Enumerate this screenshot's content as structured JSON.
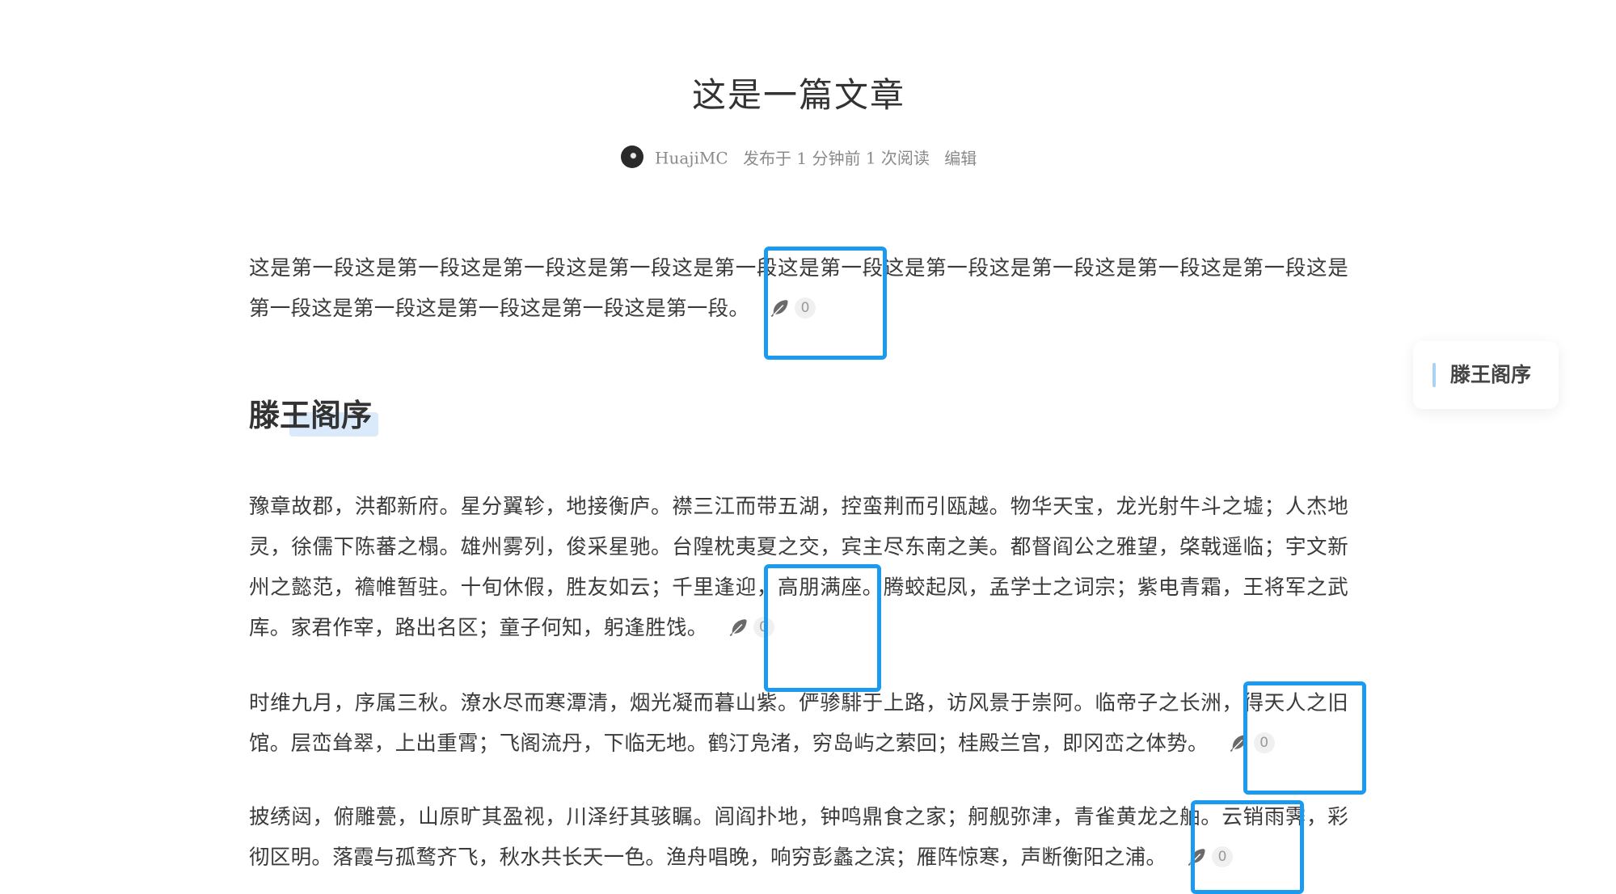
{
  "article": {
    "title": "这是一篇文章",
    "meta": {
      "author": "HuajiMC",
      "published": "发布于 1 分钟前",
      "reads": "1 次阅读",
      "edit_label": "编辑"
    },
    "paragraphs": [
      {
        "text": "这是第一段这是第一段这是第一段这是第一段这是第一段这是第一段这是第一段这是第一段这是第一段这是第一段这是第一段这是第一段这是第一段这是第一段这是第一段。",
        "comment_count": "0"
      },
      {
        "text": "豫章故郡，洪都新府。星分翼轸，地接衡庐。襟三江而带五湖，控蛮荆而引瓯越。物华天宝，龙光射牛斗之墟；人杰地灵，徐儒下陈蕃之榻。雄州雾列，俊采星驰。台隍枕夷夏之交，宾主尽东南之美。都督阎公之雅望，棨戟遥临；宇文新州之懿范，襜帷暂驻。十旬休假，胜友如云；千里逢迎，高朋满座。腾蛟起凤，孟学士之词宗；紫电青霜，王将军之武库。家君作宰，路出名区；童子何知，躬逢胜饯。",
        "comment_count": "0"
      },
      {
        "text": "时维九月，序属三秋。潦水尽而寒潭清，烟光凝而暮山紫。俨骖騑于上路，访风景于崇阿。临帝子之长洲，得天人之旧馆。层峦耸翠，上出重霄；飞阁流丹，下临无地。鹤汀凫渚，穷岛屿之萦回；桂殿兰宫，即冈峦之体势。",
        "comment_count": "0"
      },
      {
        "text": "披绣闼，俯雕甍，山原旷其盈视，川泽纡其骇瞩。闾阎扑地，钟鸣鼎食之家；舸舰弥津，青雀黄龙之舳。云销雨霁，彩彻区明。落霞与孤鹜齐飞，秋水共长天一色。渔舟唱晚，响穷彭蠡之滨；雁阵惊寒，声断衡阳之浦。",
        "comment_count": "0"
      }
    ],
    "heading": "滕王阁序"
  },
  "toc": {
    "items": [
      "滕王阁序"
    ]
  },
  "colors": {
    "highlight": "#1a9bf0",
    "toc_accent": "#a9d2f3",
    "heading_marker": "#dbeafb"
  },
  "icons": {
    "comment": "feather-icon"
  }
}
